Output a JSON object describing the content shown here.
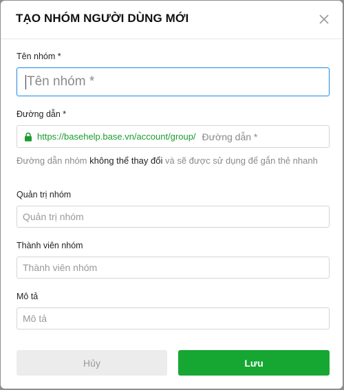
{
  "dialog": {
    "title": "TẠO NHÓM NGƯỜI DÙNG MỚI",
    "close_icon": "close-icon"
  },
  "fields": {
    "group_name": {
      "label": "Tên nhóm *",
      "placeholder": "Tên nhóm *",
      "value": ""
    },
    "path": {
      "label": "Đường dẫn *",
      "prefix": "https://basehelp.base.vn/account/group/",
      "placeholder": "Đường dẫn *",
      "value": "",
      "lock_icon": "lock-icon",
      "hint_before": "Đường dẫn nhóm ",
      "hint_bold": "không thể thay đổi",
      "hint_after": " và sẽ được sử dụng để gắn thẻ nhanh"
    },
    "admin": {
      "label": "Quản trị nhóm",
      "placeholder": "Quản trị nhóm",
      "value": ""
    },
    "members": {
      "label": "Thành viên nhóm",
      "placeholder": "Thành viên nhóm",
      "value": ""
    },
    "description": {
      "label": "Mô tả",
      "placeholder": "Mô tả",
      "value": ""
    }
  },
  "buttons": {
    "cancel": "Hủy",
    "save": "Lưu"
  },
  "colors": {
    "accent": "#16a732",
    "focus_border": "#1e88e5",
    "url_prefix": "#1a9c2f"
  }
}
